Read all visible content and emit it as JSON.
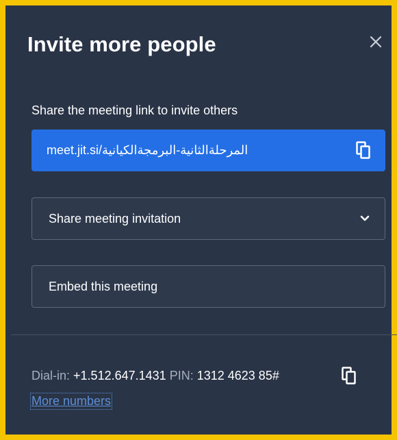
{
  "dialog": {
    "title": "Invite more people",
    "close_icon": "close-icon"
  },
  "share_link": {
    "label": "Share the meeting link to invite others",
    "url": "meet.jit.si/المرحلةالثانية-البرمجةالكيانية",
    "copy_icon": "copy-icon"
  },
  "share_invitation": {
    "label": "Share meeting invitation",
    "chevron_icon": "chevron-down-icon"
  },
  "embed": {
    "label": "Embed this meeting"
  },
  "dial_in": {
    "dial_label": "Dial-in:",
    "number": "+1.512.647.1431",
    "pin_label": "PIN:",
    "pin": "1312 4623 85#",
    "copy_icon": "copy-icon",
    "more_numbers": "More numbers"
  },
  "colors": {
    "dialog_bg": "#2a3447",
    "accent": "#246fe5",
    "frame": "#f5c400",
    "link": "#5b8fd6"
  }
}
